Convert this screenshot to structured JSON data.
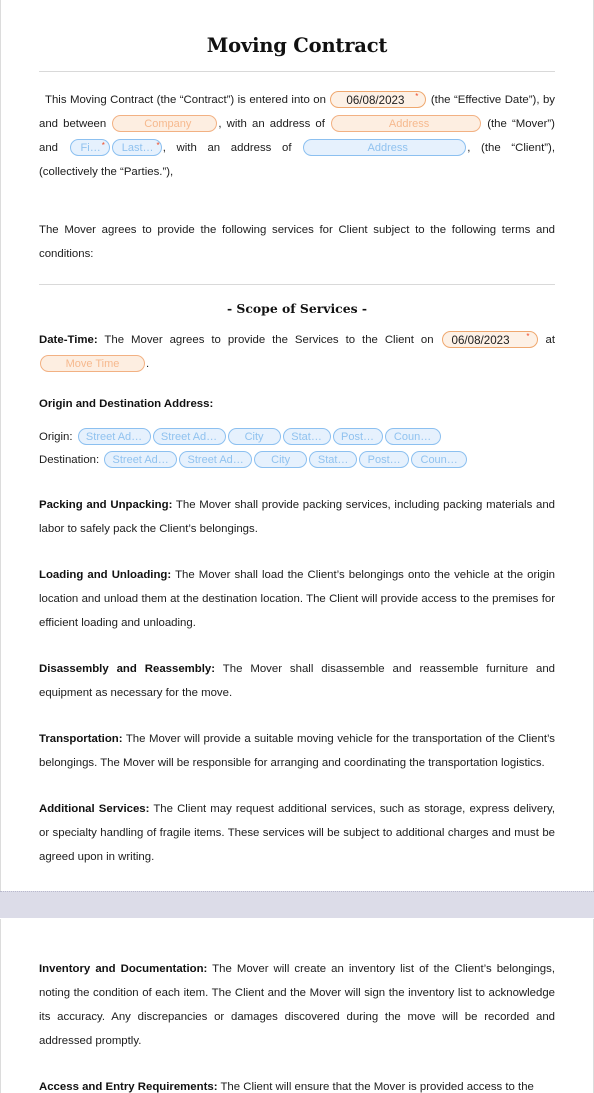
{
  "document": {
    "title": "Moving Contract"
  },
  "colors": {
    "mover_accent": "#f2b183",
    "mover_fill": "#fdeee1",
    "client_accent": "#8cc0f0",
    "client_fill": "#e6f1fd",
    "required_marker": "#ef4a28",
    "page_break": "#dcdce8",
    "text": "#1c1c1c"
  },
  "intro": {
    "t1": "This Moving Contract (the “Contract”) is entered into on",
    "t2": "(the “Effective Date”), by and between",
    "t3": ", with an address of",
    "t4": "(the “Mover”) and",
    "t5": ", with an address of",
    "t6": ", (the “Client”), (collectively the “Parties.”),",
    "effective_date": "06/08/2023",
    "company_placeholder": "Company",
    "mover_address_placeholder": "Address",
    "client_first_placeholder": "Fi…",
    "client_last_placeholder": "Last…",
    "client_address_placeholder": "Address",
    "required_marker": "*"
  },
  "preamble": {
    "text": "The Mover agrees to provide the following services for Client subject to the following terms and conditions:"
  },
  "scope": {
    "heading": "- Scope of Services -",
    "datetime_label": "Date-Time:",
    "datetime_t1": "The Mover agrees to provide the Services to the Client on",
    "datetime_t2": "at",
    "datetime_t3": ".",
    "move_date": "06/08/2023",
    "move_time_placeholder": "Move Time",
    "required_marker": "*"
  },
  "address_section": {
    "heading": "Origin and Destination Address:",
    "rows": [
      {
        "label": "Origin:",
        "fields": [
          {
            "placeholder": "Street Ad…",
            "kind": "street"
          },
          {
            "placeholder": "Street Ad…",
            "kind": "street"
          },
          {
            "placeholder": "City",
            "kind": "city"
          },
          {
            "placeholder": "Stat…",
            "kind": "state"
          },
          {
            "placeholder": "Post…",
            "kind": "post"
          },
          {
            "placeholder": "Coun…",
            "kind": "country"
          }
        ]
      },
      {
        "label": "Destination:",
        "fields": [
          {
            "placeholder": "Street Ad…",
            "kind": "street"
          },
          {
            "placeholder": "Street Ad…",
            "kind": "street"
          },
          {
            "placeholder": "City",
            "kind": "city"
          },
          {
            "placeholder": "Stat…",
            "kind": "state"
          },
          {
            "placeholder": "Post…",
            "kind": "post"
          },
          {
            "placeholder": "Coun…",
            "kind": "country"
          }
        ]
      }
    ]
  },
  "clauses": [
    {
      "label": "Packing and Unpacking:",
      "body": " The Mover shall provide packing services, including packing materials and labor to safely pack the Client’s belongings."
    },
    {
      "label": "Loading and Unloading:",
      "body": " The Mover shall load the Client’s belongings onto the vehicle at the origin location and unload them at the destination location. The Client will provide access to the premises for efficient loading and unloading."
    },
    {
      "label": "Disassembly and Reassembly:",
      "body": " The Mover shall disassemble and reassemble furniture and equipment as necessary for the move."
    },
    {
      "label": "Transportation:",
      "body": " The Mover will provide a suitable moving vehicle for the transportation of the Client’s belongings. The Mover will be responsible for arranging and coordinating the transportation logistics."
    },
    {
      "label": "Additional Services:",
      "body": " The Client may request additional services, such as storage, express delivery, or specialty handling of fragile items. These services will be subject to additional charges and must be agreed upon in writing."
    }
  ],
  "page_two_clauses": [
    {
      "label": "Inventory and Documentation:",
      "body": " The Mover will create an inventory list of the Client’s belongings, noting the condition of each item. The Client and the Mover will sign the inventory list to acknowledge its accuracy. Any discrepancies or damages discovered during the move will be recorded and addressed promptly."
    },
    {
      "label": "Access and Entry Requirements:",
      "body": " The Client will ensure that the Mover is provided access to the"
    }
  ]
}
